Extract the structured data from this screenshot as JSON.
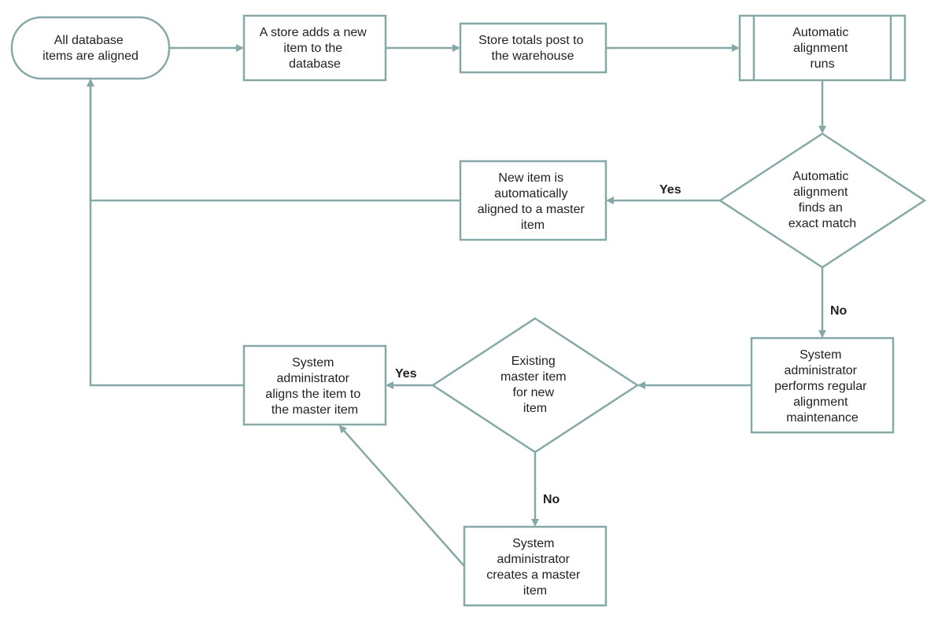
{
  "diagram": {
    "colors": {
      "stroke": "#86a9a8",
      "text": "#222222",
      "background": "#ffffff"
    },
    "nodes": {
      "start": {
        "type": "terminator",
        "lines": [
          "All database",
          "items are aligned"
        ]
      },
      "addItem": {
        "type": "process",
        "lines": [
          "A store adds a new",
          "item to the",
          "database"
        ]
      },
      "postTotals": {
        "type": "process",
        "lines": [
          "Store totals post to",
          "the warehouse"
        ]
      },
      "autoAlignRuns": {
        "type": "predefined",
        "lines": [
          "Automatic",
          "alignment",
          "runs"
        ]
      },
      "exactMatch": {
        "type": "decision",
        "lines": [
          "Automatic",
          "alignment",
          "finds an",
          "exact match"
        ]
      },
      "autoAligned": {
        "type": "process",
        "lines": [
          "New item is",
          "automatically",
          "aligned to a master",
          "item"
        ]
      },
      "maintenance": {
        "type": "process",
        "lines": [
          "System",
          "administrator",
          "performs regular",
          "alignment",
          "maintenance"
        ]
      },
      "existingMaster": {
        "type": "decision",
        "lines": [
          "Existing",
          "master item",
          "for new",
          "item"
        ]
      },
      "alignMaster": {
        "type": "process",
        "lines": [
          "System",
          "administrator",
          "aligns the item to",
          "the master item"
        ]
      },
      "createMaster": {
        "type": "process",
        "lines": [
          "System",
          "administrator",
          "creates a master",
          "item"
        ]
      }
    },
    "edgeLabels": {
      "yes1": "Yes",
      "no1": "No",
      "yes2": "Yes",
      "no2": "No"
    }
  }
}
